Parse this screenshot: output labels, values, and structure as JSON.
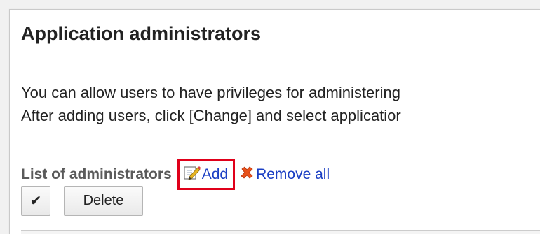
{
  "page": {
    "title": "Application administrators"
  },
  "description": {
    "line1": "You can allow users to have privileges for administering",
    "line2": "After adding users, click [Change] and select applicatior"
  },
  "list": {
    "title": "List of administrators",
    "add_label": "Add",
    "remove_all_label": "Remove all"
  },
  "actions": {
    "select_all_label": "✔",
    "delete_label": "Delete"
  },
  "colors": {
    "link": "#1b3fc4",
    "highlight": "#e0001a",
    "remove_icon": "#e8521a"
  },
  "icons": {
    "add": "edit-icon",
    "remove_all": "x-icon"
  }
}
